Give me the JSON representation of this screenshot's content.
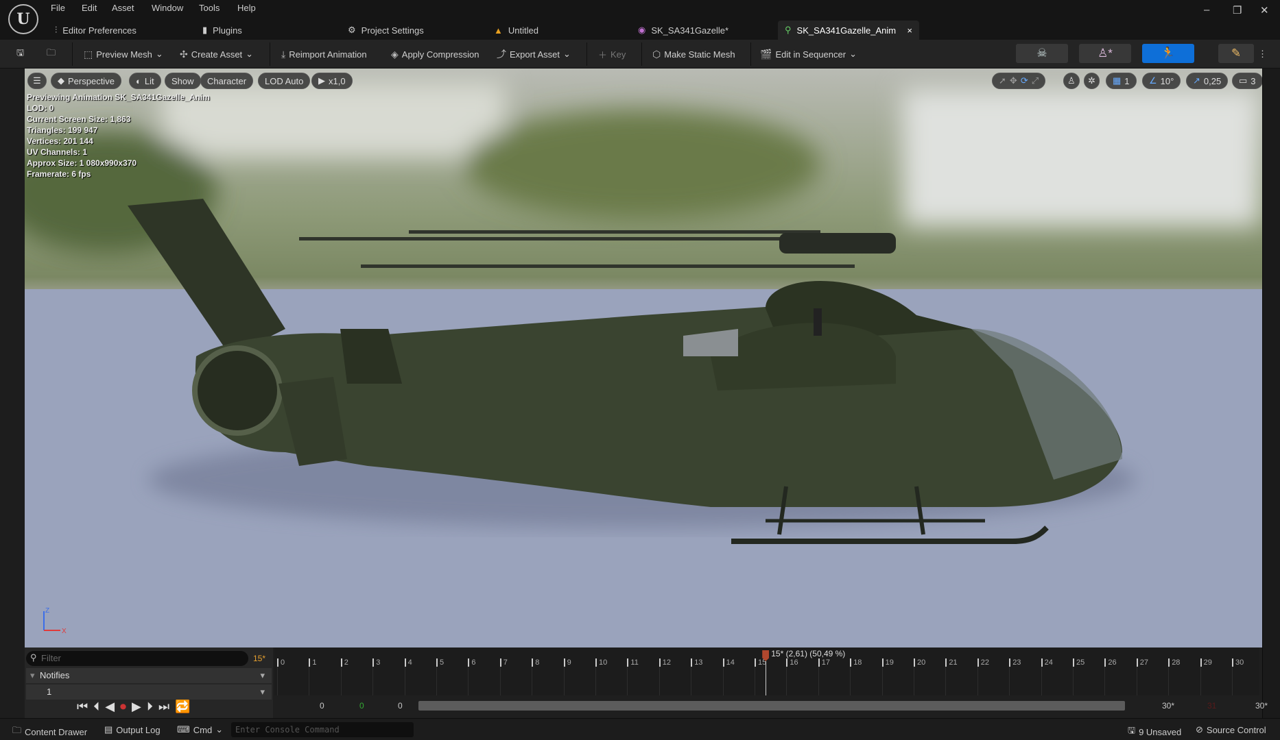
{
  "menu": [
    "File",
    "Edit",
    "Asset",
    "Window",
    "Tools",
    "Help"
  ],
  "tabs": [
    {
      "label": "Editor Preferences",
      "icon": "sliders-icon"
    },
    {
      "label": "Plugins",
      "icon": "plug-icon"
    },
    {
      "label": "Project Settings",
      "icon": "gear-icon"
    },
    {
      "label": "Untitled",
      "icon": "level-icon"
    },
    {
      "label": "SK_SA341Gazelle*",
      "icon": "skeleton-asset-icon"
    },
    {
      "label": "SK_SA341Gazelle_Anim",
      "icon": "animation-icon",
      "close": "×"
    }
  ],
  "toolbar": {
    "preview_mesh": "Preview Mesh",
    "create_asset": "Create Asset",
    "reimport": "Reimport Animation",
    "apply_compression": "Apply Compression",
    "export_asset": "Export Asset",
    "key": "Key",
    "make_static_mesh": "Make Static Mesh",
    "edit_in_sequencer": "Edit in Sequencer"
  },
  "viewport": {
    "buttons": {
      "perspective": "Perspective",
      "lit": "Lit",
      "show": "Show",
      "character": "Character",
      "lod": "LOD Auto",
      "play_rate": "x1,0"
    },
    "right": {
      "grid": "1",
      "angle": "10°",
      "scale": "0,25",
      "camera_speed": "3"
    },
    "stats": [
      "Previewing Animation SK_SA341Gazelle_Anim",
      "LOD: 0",
      "Current Screen Size: 1,863",
      "Triangles: 199 947",
      "Vertices: 201 144",
      "UV Channels: 1",
      "Approx Size: 1 080x990x370",
      "Framerate: 6 fps"
    ],
    "axis": {
      "z": "Z",
      "x": "X"
    }
  },
  "timeline": {
    "filter_placeholder": "Filter",
    "current_frame": "15*",
    "notifies": "Notifies",
    "track": "1",
    "playhead_label": "15* (2,61) (50,49 %)",
    "playhead_frame": 15.35,
    "frames": 30,
    "start_values": [
      "0",
      "0",
      "0"
    ],
    "end_values": [
      "30*",
      "31",
      "30*"
    ]
  },
  "status": {
    "content_drawer": "Content Drawer",
    "output_log": "Output Log",
    "cmd": "Cmd",
    "console_placeholder": "Enter Console Command",
    "unsaved": "9 Unsaved",
    "source_control": "Source Control"
  },
  "colors": {
    "accent": "#0e6fd8",
    "playhead": "#b0472e"
  }
}
